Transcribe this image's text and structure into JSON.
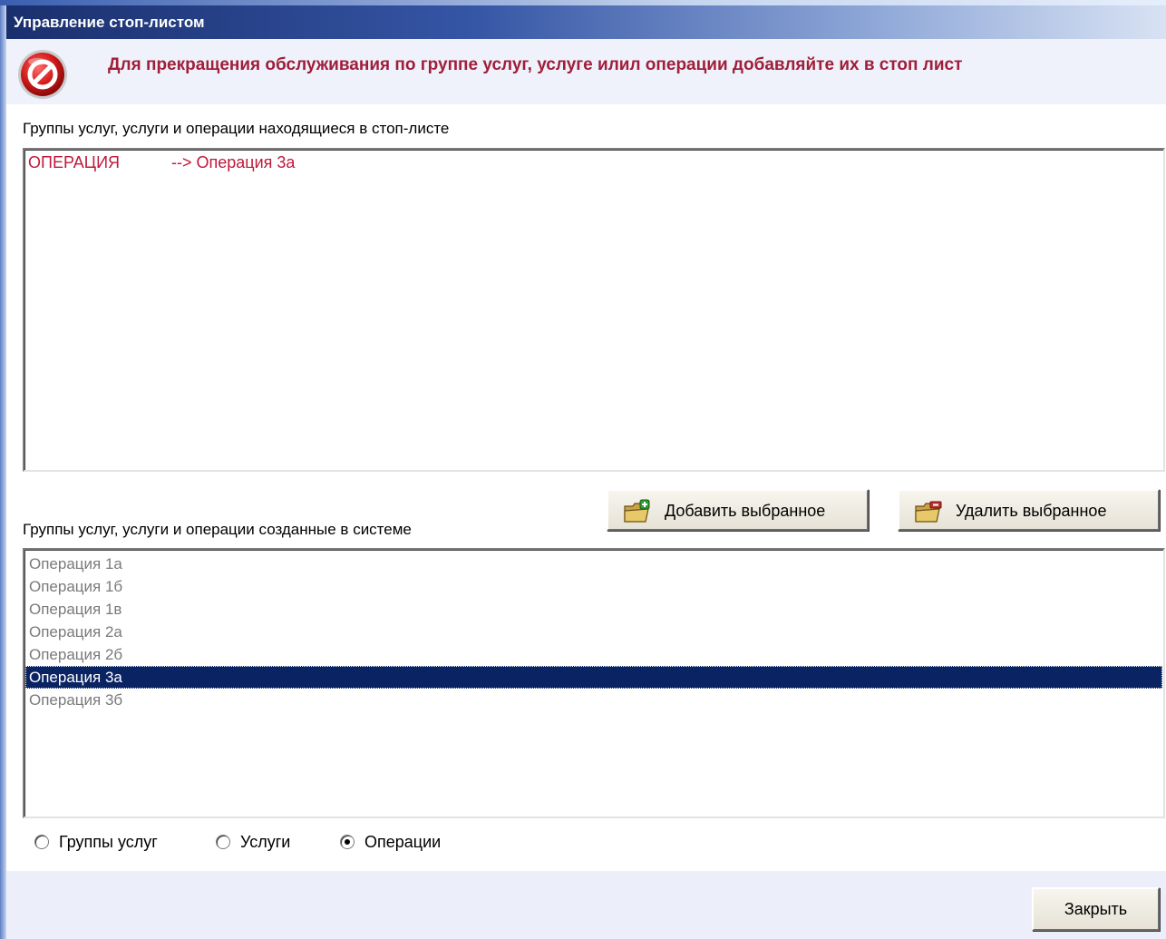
{
  "window": {
    "title": "Управление стоп-листом"
  },
  "header": {
    "icon": "stop-sign-icon",
    "message": "Для прекращения обслуживания по группе услуг, услуге илил операции добавляйте их в стоп лист"
  },
  "stop_list": {
    "label": "Группы услуг, услуги и операции находящиеся в стоп-листе",
    "items": [
      {
        "type": "ОПЕРАЦИЯ",
        "name": "--> Операция 3а"
      }
    ]
  },
  "actions": {
    "add_label": "Добавить выбранное",
    "remove_label": "Удалить выбранное"
  },
  "system_list": {
    "label": "Группы услуг, услуги и операции созданные в системе",
    "items": [
      "Операция 1а",
      "Операция 1б",
      "Операция 1в",
      "Операция 2а",
      "Операция 2б",
      "Операция 3а",
      "Операция 3б"
    ],
    "selected": "Операция 3а"
  },
  "filter": {
    "options": [
      "Группы услуг",
      "Услуги",
      "Операции"
    ],
    "selected": "Операции"
  },
  "footer": {
    "close_label": "Закрыть"
  },
  "colors": {
    "header_message": "#a01e3a",
    "stop_item": "#c0183a",
    "selection": "#0a2463"
  }
}
